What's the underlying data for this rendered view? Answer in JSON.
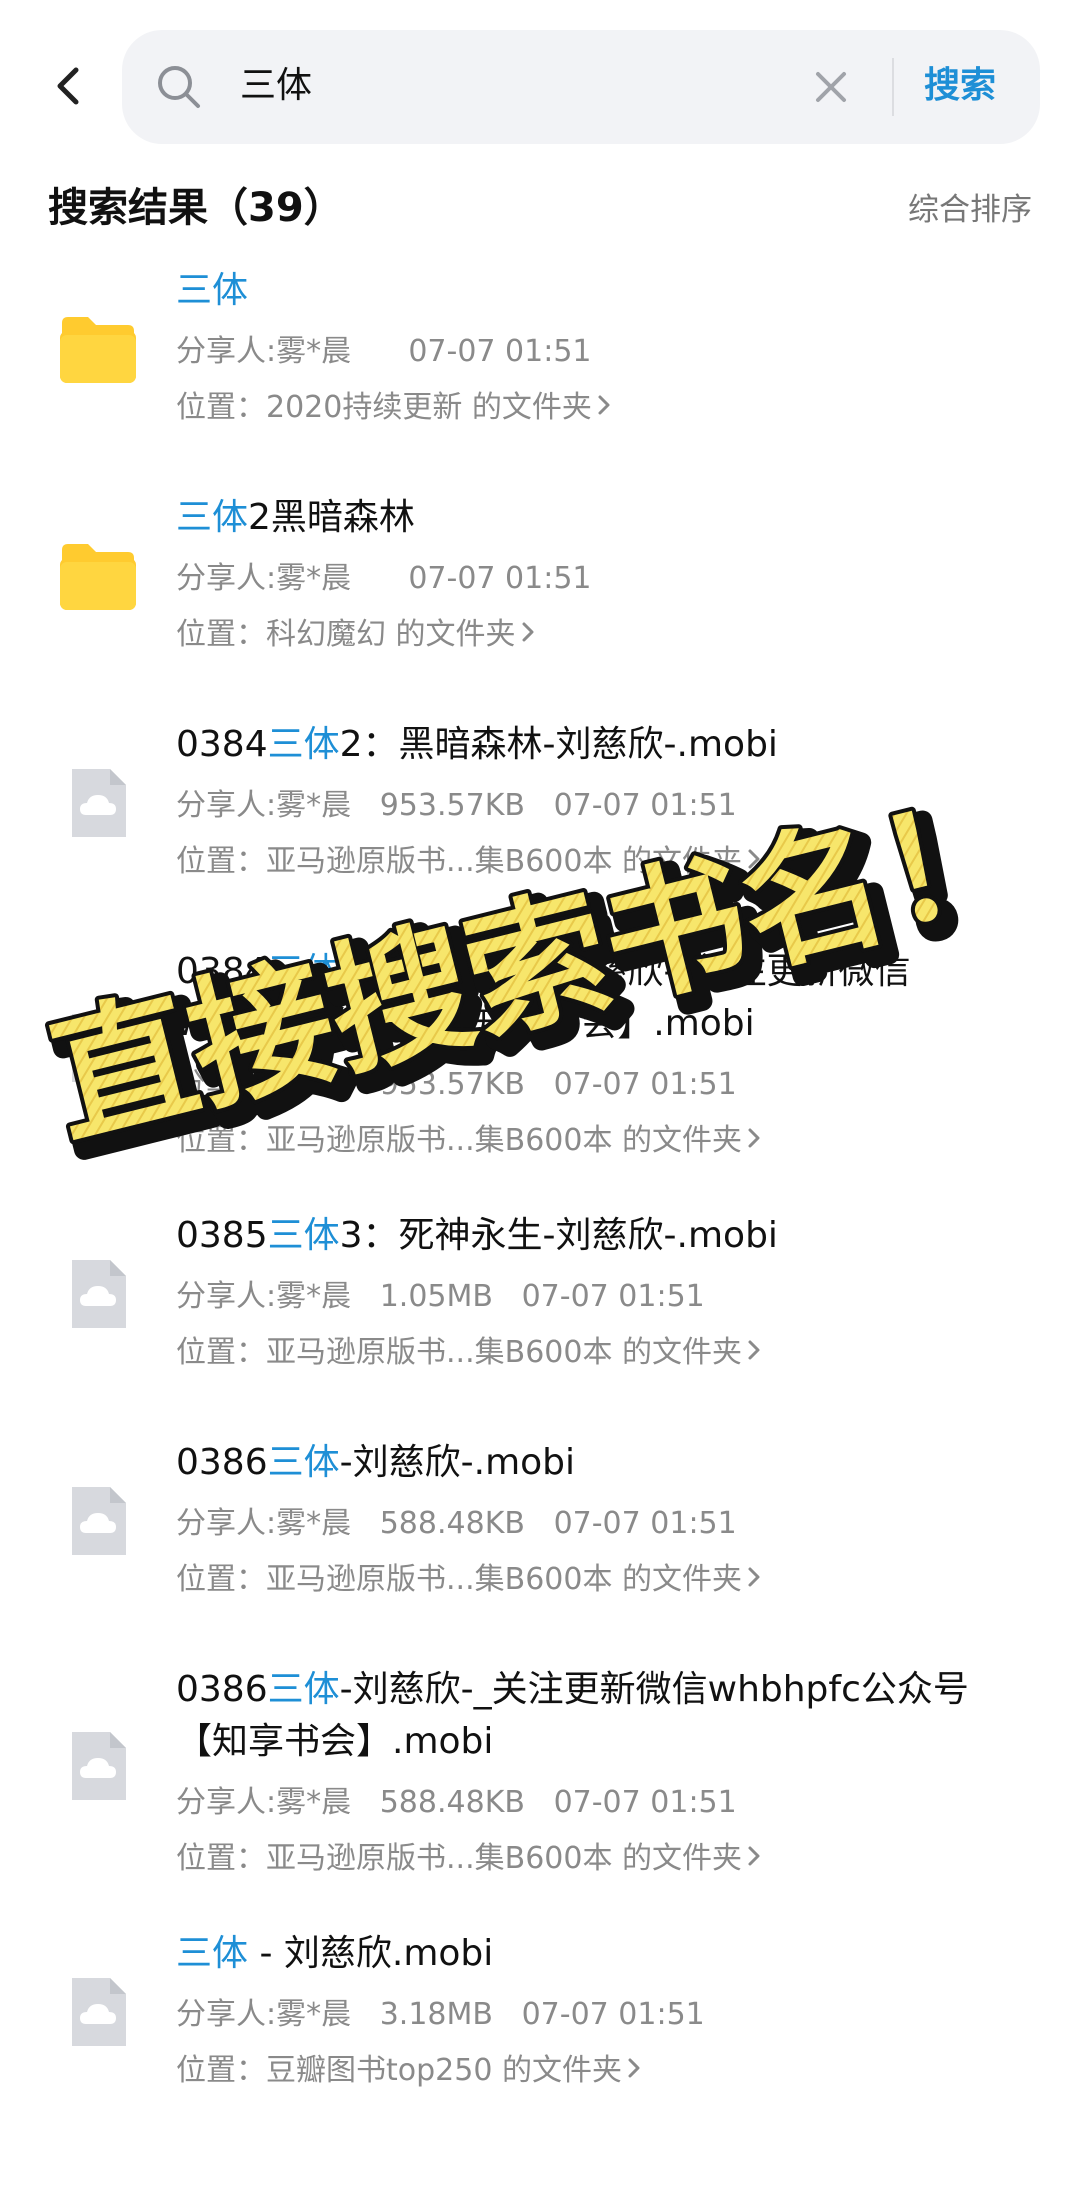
{
  "search": {
    "query": "三体",
    "button_label": "搜索"
  },
  "results": {
    "title": "搜索结果（39）",
    "sort_label": "综合排序"
  },
  "items": [
    {
      "type": "folder",
      "title_pre": "",
      "title_hl": "三体",
      "title_post": "",
      "sharer": "分享人:雾*晨",
      "size": "",
      "date": "07-07 01:51",
      "location": "位置：2020持续更新 的文件夹"
    },
    {
      "type": "folder",
      "title_pre": "",
      "title_hl": "三体",
      "title_post": "2黑暗森林",
      "sharer": "分享人:雾*晨",
      "size": "",
      "date": "07-07 01:51",
      "location": "位置：科幻魔幻 的文件夹"
    },
    {
      "type": "file",
      "title_pre": "0384",
      "title_hl": "三体",
      "title_post": "2：黑暗森林-刘慈欣-.mobi",
      "sharer": "分享人:雾*晨",
      "size": "953.57KB",
      "date": "07-07 01:51",
      "location": "位置：亚马逊原版书...集B600本 的文件夹"
    },
    {
      "type": "file",
      "title_pre": "0384",
      "title_hl": "三体",
      "title_post": "2：黑暗森林-刘慈欣-_关注更新微信whbhpfc公众号【知享书会】.mobi",
      "sharer": "分享人:雾*晨",
      "size": "953.57KB",
      "date": "07-07 01:51",
      "location": "位置：亚马逊原版书...集B600本 的文件夹"
    },
    {
      "type": "file",
      "title_pre": "0385",
      "title_hl": "三体",
      "title_post": "3：死神永生-刘慈欣-.mobi",
      "sharer": "分享人:雾*晨",
      "size": "1.05MB",
      "date": "07-07 01:51",
      "location": "位置：亚马逊原版书...集B600本 的文件夹"
    },
    {
      "type": "file",
      "title_pre": "0386",
      "title_hl": "三体",
      "title_post": "-刘慈欣-.mobi",
      "sharer": "分享人:雾*晨",
      "size": "588.48KB",
      "date": "07-07 01:51",
      "location": "位置：亚马逊原版书...集B600本 的文件夹"
    },
    {
      "type": "file",
      "title_pre": "0386",
      "title_hl": "三体",
      "title_post": "-刘慈欣-_关注更新微信whbhpfc公众号【知享书会】.mobi",
      "sharer": "分享人:雾*晨",
      "size": "588.48KB",
      "date": "07-07 01:51",
      "location": "位置：亚马逊原版书...集B600本 的文件夹"
    },
    {
      "type": "file",
      "title_pre": "",
      "title_hl": "三体",
      "title_post": " - 刘慈欣.mobi",
      "sharer": "分享人:雾*晨",
      "size": "3.18MB",
      "date": "07-07 01:51",
      "location": "位置：豆瓣图书top250 的文件夹"
    }
  ],
  "overlay": {
    "text": "直接搜索书名！",
    "fill_color": "#f7e66b",
    "stroke_color": "#111111"
  },
  "colors": {
    "accent": "#1e8fd6",
    "folder": "#ffcb2f",
    "file_icon": "#d7d9de"
  }
}
